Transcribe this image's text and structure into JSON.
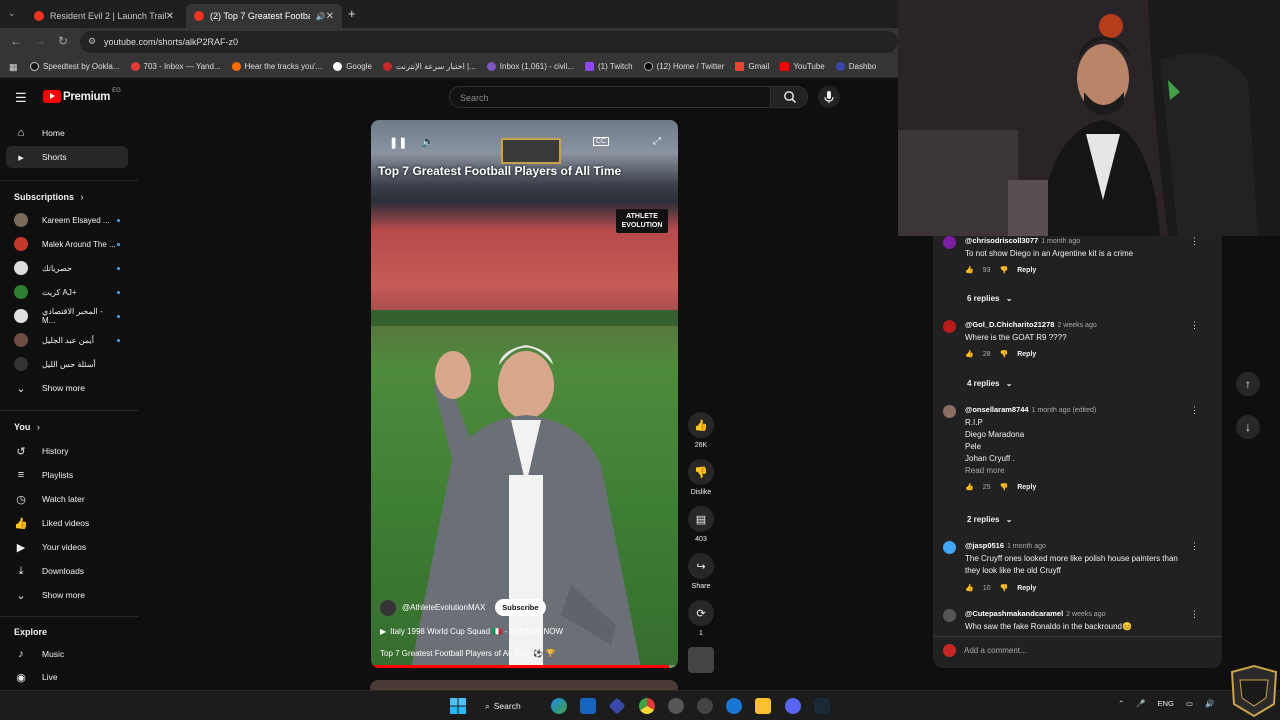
{
  "browser": {
    "tabs": [
      {
        "label": "Resident Evil 2 | Launch Trailer |",
        "active": false
      },
      {
        "label": "(2) Top 7 Greatest Football",
        "active": true
      }
    ],
    "new_tab": "+",
    "url": "youtube.com/shorts/alkP2RAF-z0",
    "bookmarks": [
      "Speedtest by Ookla...",
      "703 - Inbox — Yand...",
      "Hear the tracks you'...",
      "Google",
      "اختبار سرعة الإنترنت |...",
      "Inbox (1,061) - civil...",
      "(1) Twitch",
      "(12) Home / Twitter",
      "Gmail",
      "YouTube",
      "Dashbo"
    ]
  },
  "header": {
    "logo": "Premium",
    "logo_region": "EG",
    "search_placeholder": "Search"
  },
  "sidebar": {
    "main": [
      {
        "label": "Home",
        "icon": "home-icon"
      },
      {
        "label": "Shorts",
        "icon": "shorts-icon",
        "active": true
      }
    ],
    "subscriptions_title": "Subscriptions",
    "subscriptions": [
      {
        "label": "Kareem Elsayed ...",
        "color": "#7a6a5a"
      },
      {
        "label": "Malek Around The ...",
        "color": "#c0392b"
      },
      {
        "label": "حصرياتك",
        "color": "#888"
      },
      {
        "label": "كريت AJ+",
        "color": "#2e7d32"
      },
      {
        "label": "المحبر الاقتصادي - M...",
        "color": "#5d4037"
      },
      {
        "label": "أيمن عبد الجليل",
        "color": "#6d4c41"
      },
      {
        "label": "أسئلة حس الليل",
        "color": "#333"
      }
    ],
    "subs_show_more": "Show more",
    "you_title": "You",
    "you_items": [
      {
        "label": "History",
        "icon": "history-icon"
      },
      {
        "label": "Playlists",
        "icon": "playlists-icon"
      },
      {
        "label": "Watch later",
        "icon": "clock-icon"
      },
      {
        "label": "Liked videos",
        "icon": "thumbs-up-icon"
      },
      {
        "label": "Your videos",
        "icon": "video-icon"
      },
      {
        "label": "Downloads",
        "icon": "download-icon"
      }
    ],
    "you_show_more": "Show more",
    "explore_title": "Explore",
    "explore_items": [
      {
        "label": "Music",
        "icon": "music-icon"
      },
      {
        "label": "Live",
        "icon": "live-icon"
      }
    ]
  },
  "short": {
    "title": "Top 7 Greatest Football Players of All Time",
    "badge_line1": "ATHLETE",
    "badge_line2": "EVOLUTION",
    "channel": "@AthleteEvolutionMAX",
    "subscribe": "Subscribe",
    "playlist": "Italy 1998 World Cup Squad 🇮🇹 - THEN vs NOW",
    "description": "Top 7 Greatest Football Players of All Time ⚽ 🏆",
    "progress": 0.97
  },
  "actions": {
    "like_count": "26K",
    "dislike_label": "Dislike",
    "comments_count": "403",
    "share_label": "Share",
    "remix_count": "1"
  },
  "comments": [
    {
      "author": "@chrisodriscoll3077",
      "time": "1 month ago",
      "text": "To not show Diego in an Argentine kit is a crime",
      "likes": "93",
      "avatar_color": "#7b1fa2"
    },
    {
      "replies": "6 replies"
    },
    {
      "author": "@Gol_D.Chicharito21278",
      "time": "2 weeks ago",
      "text": "Where is the GOAT R9 ????",
      "likes": "28",
      "avatar_color": "#b71c1c"
    },
    {
      "replies": "4 replies"
    },
    {
      "author": "@onsellaram8744",
      "time": "1 month ago (edited)",
      "text_lines": [
        "R.I.P",
        "Diego Maradona",
        "Pele",
        "Johan Cryuff ."
      ],
      "read_more": "Read more",
      "likes": "25",
      "avatar_color": "#8d6e63"
    },
    {
      "replies": "2 replies"
    },
    {
      "author": "@jasp0516",
      "time": "1 month ago",
      "text_lines": [
        "The Cruyff ones looked more like polish house painters than",
        "they look like the old Cruyff"
      ],
      "likes": "10",
      "avatar_color": "#42a5f5"
    },
    {
      "author": "@Cutepashmakandcaramel",
      "time": "2 weeks ago",
      "text": "Who saw the fake Ronaldo in the backround😊",
      "avatar_color": "#555"
    }
  ],
  "reply_label": "Reply",
  "add_comment_placeholder": "Add a comment...",
  "taskbar": {
    "search": "Search",
    "lang": "ENG"
  }
}
